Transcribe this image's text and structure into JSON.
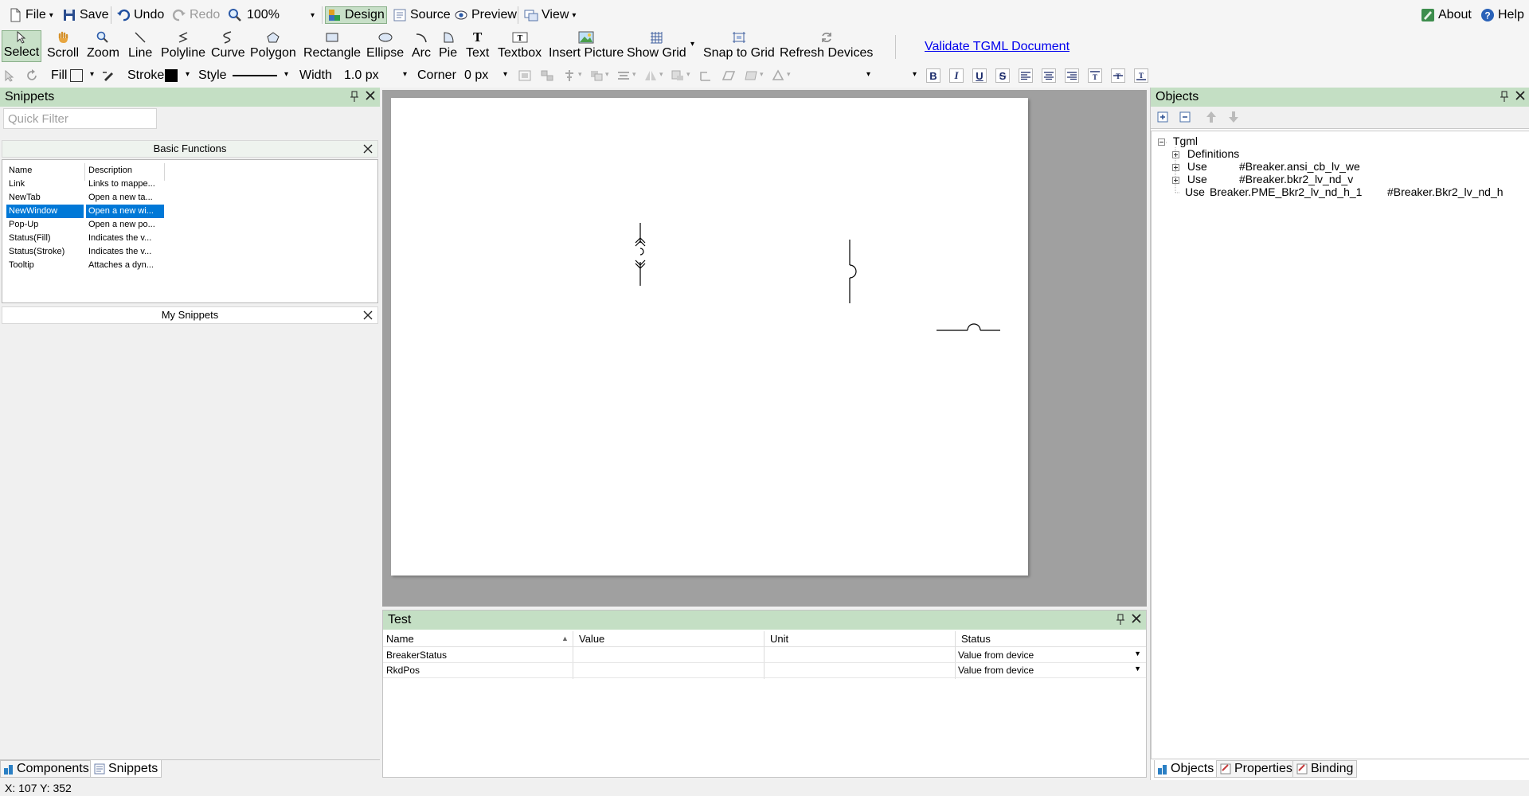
{
  "menubar": {
    "file": "File",
    "save": "Save",
    "undo": "Undo",
    "redo": "Redo",
    "zoom": "100%",
    "design": "Design",
    "source": "Source",
    "preview": "Preview",
    "view": "View",
    "about": "About",
    "help": "Help"
  },
  "tools": {
    "select": "Select",
    "scroll": "Scroll",
    "zoom": "Zoom",
    "line": "Line",
    "polyline": "Polyline",
    "curve": "Curve",
    "polygon": "Polygon",
    "rectangle": "Rectangle",
    "ellipse": "Ellipse",
    "arc": "Arc",
    "pie": "Pie",
    "text": "Text",
    "textbox": "Textbox",
    "insert_picture": "Insert Picture",
    "show_grid": "Show Grid",
    "snap_to_grid": "Snap to Grid",
    "refresh_devices": "Refresh Devices",
    "validate": "Validate TGML Document"
  },
  "format": {
    "fill": "Fill",
    "stroke": "Stroke",
    "style": "Style",
    "width_label": "Width",
    "width_value": "1.0 px",
    "corner_label": "Corner",
    "corner_value": "0 px",
    "bold": "B",
    "italic": "I",
    "underline": "U",
    "strike": "S",
    "stroke_color": "#000000",
    "fill_color": "#ffffff"
  },
  "snippets": {
    "title": "Snippets",
    "filter_placeholder": "Quick Filter",
    "basic_title": "Basic Functions",
    "col_name": "Name",
    "col_desc": "Description",
    "rows": [
      {
        "name": "Link",
        "desc": "Links to mappe..."
      },
      {
        "name": "NewTab",
        "desc": "Open a new ta..."
      },
      {
        "name": "NewWindow",
        "desc": "Open a new wi..."
      },
      {
        "name": "Pop-Up",
        "desc": "Open a new po..."
      },
      {
        "name": "Status(Fill)",
        "desc": "Indicates the v..."
      },
      {
        "name": "Status(Stroke)",
        "desc": "Indicates the v..."
      },
      {
        "name": "Tooltip",
        "desc": "Attaches a dyn..."
      }
    ],
    "my_title": "My Snippets",
    "tab_components": "Components",
    "tab_snippets": "Snippets"
  },
  "test": {
    "title": "Test",
    "col_name": "Name",
    "col_value": "Value",
    "col_unit": "Unit",
    "col_status": "Status",
    "rows": [
      {
        "name": "BreakerStatus",
        "value": "",
        "unit": "",
        "status": "Value from device"
      },
      {
        "name": "RkdPos",
        "value": "",
        "unit": "",
        "status": "Value from device"
      }
    ]
  },
  "objects": {
    "title": "Objects",
    "root": "Tgml",
    "items": [
      {
        "type": "Definitions",
        "id": "",
        "ref": ""
      },
      {
        "type": "Use",
        "id": "",
        "ref": "#Breaker.ansi_cb_lv_we"
      },
      {
        "type": "Use",
        "id": "",
        "ref": "#Breaker.bkr2_lv_nd_v"
      },
      {
        "type": "Use",
        "id": "Breaker.PME_Bkr2_lv_nd_h_1",
        "ref": "#Breaker.Bkr2_lv_nd_h"
      }
    ],
    "tab_objects": "Objects",
    "tab_properties": "Properties",
    "tab_binding": "Binding"
  },
  "status": {
    "coords": "X: 107  Y: 352"
  }
}
